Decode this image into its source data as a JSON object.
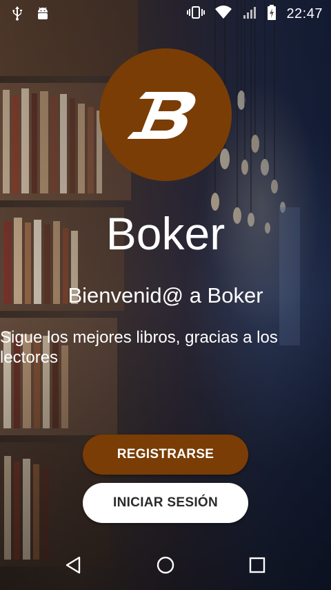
{
  "status_bar": {
    "time": "22:47",
    "icons": [
      "usb-icon",
      "android-icon",
      "vibrate-icon",
      "wifi-icon",
      "signal-icon",
      "battery-icon"
    ]
  },
  "logo": {
    "letter": "B",
    "color": "#7a3d05"
  },
  "app": {
    "title": "Boker",
    "welcome": "Bienvenid@ a Boker",
    "subtitle": "Sigue los mejores libros, gracias a los lectores"
  },
  "buttons": {
    "register_label": "REGISTRARSE",
    "login_label": "INICIAR SESIÓN"
  },
  "colors": {
    "brand": "#7a3d05",
    "text": "#ffffff"
  },
  "nav_bar": {
    "icons": [
      "back-icon",
      "home-icon",
      "recents-icon"
    ]
  }
}
